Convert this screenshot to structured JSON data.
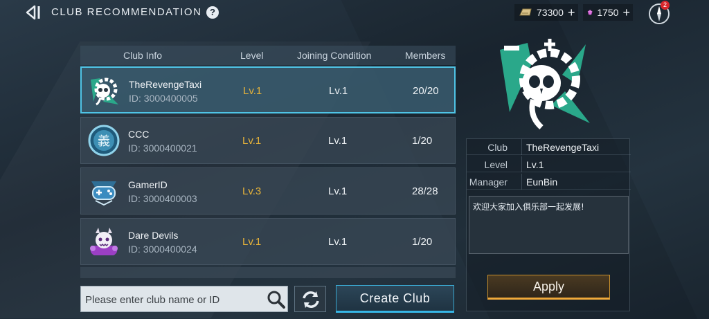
{
  "header": {
    "title": "CLUB RECOMMENDATION",
    "help": "?"
  },
  "currency": {
    "gold": "73300",
    "gems": "1750",
    "plus": "+"
  },
  "notifications": {
    "count": "2"
  },
  "table": {
    "columns": [
      "Club Info",
      "Level",
      "Joining Condition",
      "Members"
    ],
    "rows": [
      {
        "name": "TheRevengeTaxi",
        "id": "ID: 3000400005",
        "level": "Lv.1",
        "condition": "Lv.1",
        "members": "20/20",
        "icon": "skull-gear-emblem-icon"
      },
      {
        "name": "CCC",
        "id": "ID: 3000400021",
        "level": "Lv.1",
        "condition": "Lv.1",
        "members": "1/20",
        "icon": "yi-character-badge-icon",
        "badge_char": "義"
      },
      {
        "name": "GamerID",
        "id": "ID: 3000400003",
        "level": "Lv.3",
        "condition": "Lv.1",
        "members": "28/28",
        "icon": "gamepad-emblem-icon"
      },
      {
        "name": "Dare Devils",
        "id": "ID: 3000400024",
        "level": "Lv.1",
        "condition": "Lv.1",
        "members": "1/20",
        "icon": "purple-devil-emblem-icon"
      }
    ]
  },
  "search": {
    "placeholder": "Please enter club name or ID"
  },
  "buttons": {
    "create": "Create Club",
    "apply": "Apply"
  },
  "details": {
    "club_label": "Club",
    "club_value": "TheRevengeTaxi",
    "level_label": "Level",
    "level_value": "Lv.1",
    "manager_label": "Manager",
    "manager_value": "EunBin",
    "description": "欢迎大家加入俱乐部一起发展!"
  },
  "colors": {
    "accent_cyan": "#4fc4e6",
    "level_gold": "#e6b33a",
    "apply_orange": "#f0a93a",
    "emblem_teal": "#2aa88a"
  }
}
